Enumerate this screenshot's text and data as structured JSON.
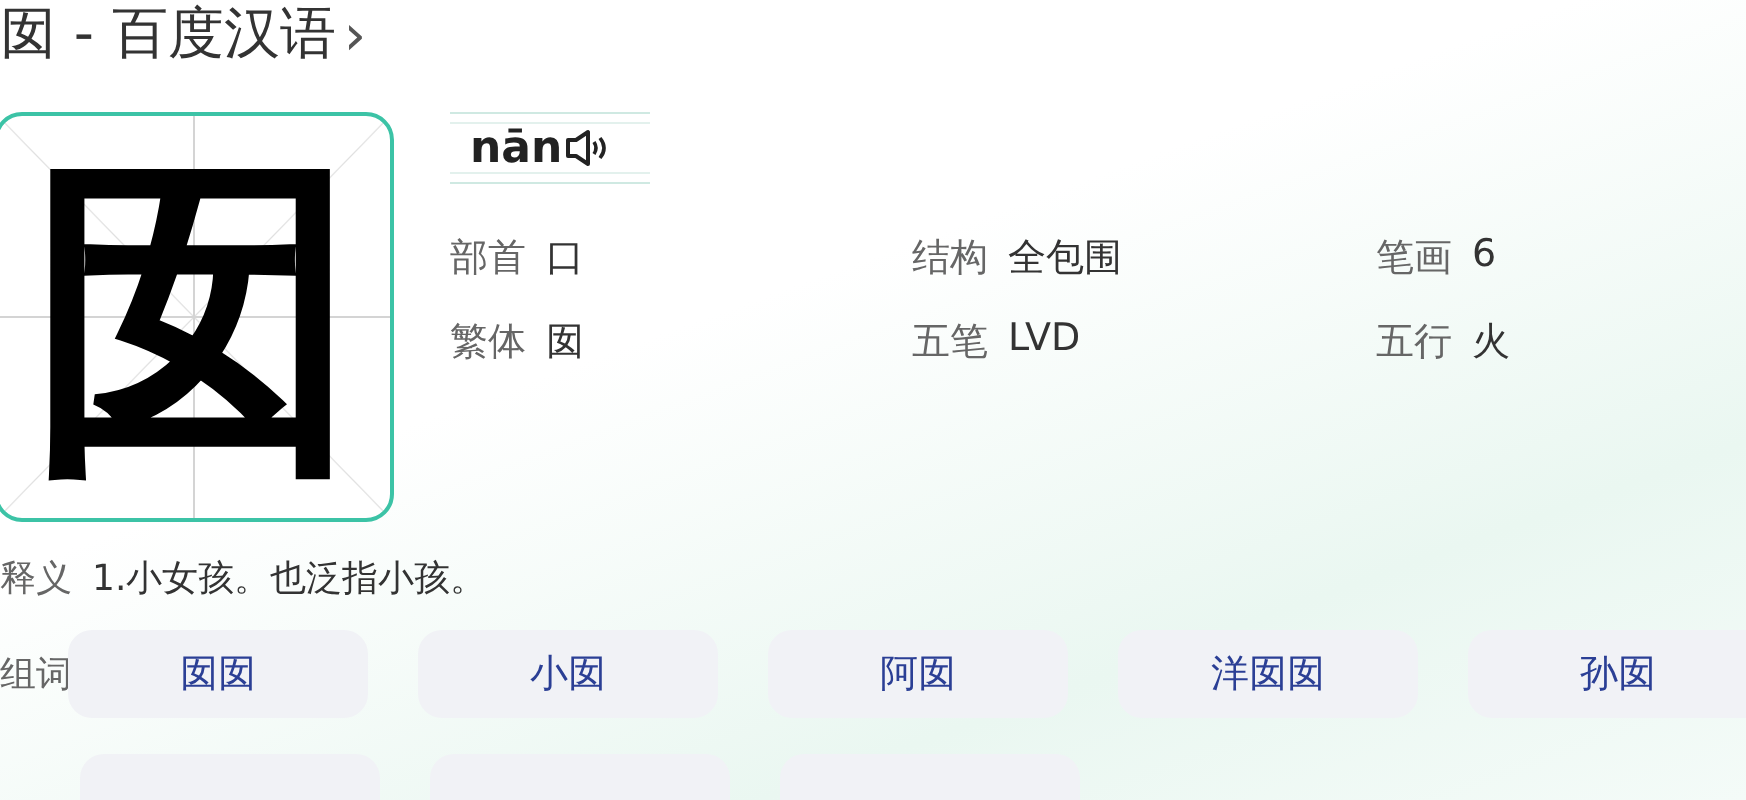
{
  "title": {
    "text": "囡 - 百度汉语",
    "chevron": "›"
  },
  "character": {
    "glyph": "囡"
  },
  "pinyin": {
    "text": "nān"
  },
  "attributes": [
    {
      "label": "部首",
      "value": "口"
    },
    {
      "label": "结构",
      "value": "全包围"
    },
    {
      "label": "笔画",
      "value": "6"
    },
    {
      "label": "繁体",
      "value": "囡"
    },
    {
      "label": "五笔",
      "value": "LVD"
    },
    {
      "label": "五行",
      "value": "火"
    }
  ],
  "definition": {
    "label": "释义",
    "text": "1.小女孩。也泛指小孩。"
  },
  "words": {
    "label": "组词",
    "items": [
      "囡囡",
      "小囡",
      "阿囡",
      "洋囡囡",
      "孙囡"
    ],
    "hidden_row": [
      {
        "kind": "word-chip"
      },
      {
        "kind": "word-chip"
      },
      {
        "kind": "word-chip"
      }
    ]
  }
}
